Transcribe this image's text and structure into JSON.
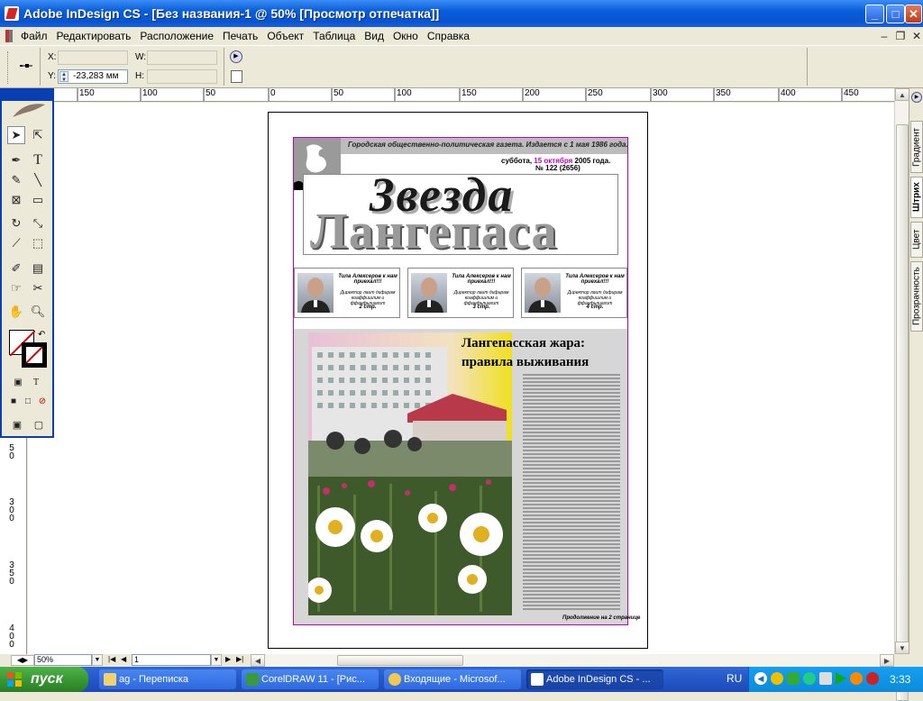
{
  "window": {
    "title": "Adobe InDesign CS - [Без названия-1 @ 50% [Просмотр отпечатка]]",
    "minimize": "_",
    "maximize": "□",
    "close": "✕"
  },
  "menu": [
    "Файл",
    "Редактировать",
    "Расположение",
    "Печать",
    "Объект",
    "Таблица",
    "Вид",
    "Окно",
    "Справка"
  ],
  "control": {
    "x_label": "X:",
    "y_label": "Y:",
    "w_label": "W:",
    "h_label": "H:",
    "x_value": "",
    "y_value": "-23,283 мм",
    "w_value": "",
    "h_value": ""
  },
  "ruler": {
    "h_labels": [
      "150",
      "100",
      "50",
      "0",
      "50",
      "100",
      "150",
      "200",
      "250",
      "300",
      "350",
      "400",
      "450"
    ],
    "v_labels": [
      "50",
      "300",
      "350",
      "400"
    ]
  },
  "status": {
    "zoom": "50%",
    "page": "1"
  },
  "panel_tabs": [
    "Градиент",
    "Штрих",
    "Цвет",
    "Прозрачность"
  ],
  "newspaper": {
    "tagline": "Городская общественно-политическая газета. Издается с 1 мая 1986 года.",
    "date_prefix": "суббота,",
    "date_highlight": "15 октября",
    "date_suffix": "2005 года.",
    "issue": "№ 122 (2656)",
    "masthead_line1": "Звезда",
    "masthead_line2": "Лангепаса",
    "teasers": [
      {
        "title": "Тила Алексеров к нам приехал!!!",
        "subtitle": "Директор лаит дифирам коаффишлим и ффанфьлиалит",
        "page": "2 стр."
      },
      {
        "title": "Тила Алексеров к нам приехал!!!",
        "subtitle": "Директор лаит дифирам коаффишлим и ффанфьлиалит",
        "page": "3 стр."
      },
      {
        "title": "Тила Алексеров к нам приехал!!!",
        "subtitle": "Директор лаит дифирам коаффишлим и ффанфьлиалит",
        "page": "4 стр."
      }
    ],
    "headline_line1": "Лангепасская жара:",
    "headline_line2": "правила выживания",
    "continuation": "Продолжение на 2 странице"
  },
  "taskbar": {
    "start": "пуск",
    "tasks": [
      "ag - Переписка",
      "CorelDRAW 11 - [Рис...",
      "Входящие - Microsof...",
      "Adobe InDesign CS - ..."
    ],
    "lang": "RU",
    "clock": "3:33"
  },
  "colors": {
    "magenta_frame": "#c000c0",
    "titlebar": "#0a5fd8",
    "taskbar": "#245ad0",
    "start": "#36932f"
  }
}
